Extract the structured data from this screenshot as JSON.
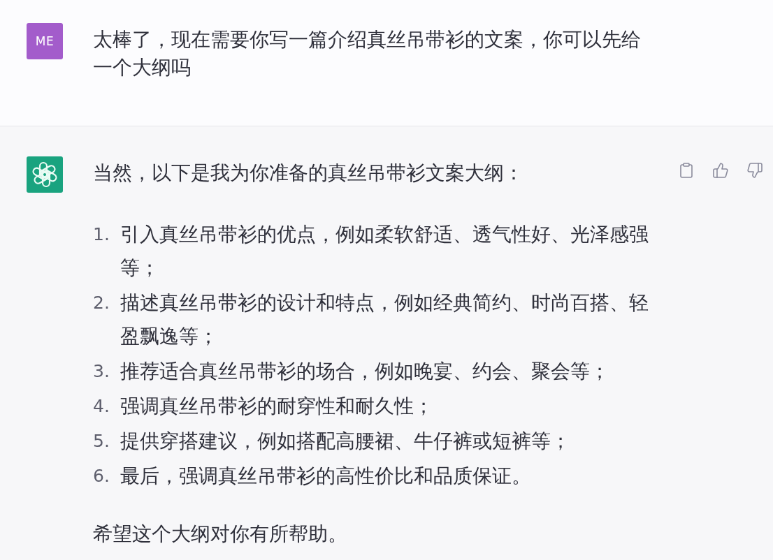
{
  "messages": [
    {
      "kind": "user",
      "avatar_text": "ME",
      "text": "太棒了，现在需要你写一篇介绍真丝吊带衫的文案，你可以先给一个大纲吗"
    },
    {
      "kind": "assistant",
      "intro": "当然，以下是我为你准备的真丝吊带衫文案大纲：",
      "list": [
        {
          "number": "1.",
          "text": "引入真丝吊带衫的优点，例如柔软舒适、透气性好、光泽感强等；"
        },
        {
          "number": "2.",
          "text": "描述真丝吊带衫的设计和特点，例如经典简约、时尚百搭、轻盈飘逸等；"
        },
        {
          "number": "3.",
          "text": "推荐适合真丝吊带衫的场合，例如晚宴、约会、聚会等；"
        },
        {
          "number": "4.",
          "text": "强调真丝吊带衫的耐穿性和耐久性；"
        },
        {
          "number": "5.",
          "text": "提供穿搭建议，例如搭配高腰裙、牛仔裤或短裤等；"
        },
        {
          "number": "6.",
          "text": "最后，强调真丝吊带衫的高性价比和品质保证。"
        }
      ],
      "closing": "希望这个大纲对你有所帮助。"
    }
  ]
}
